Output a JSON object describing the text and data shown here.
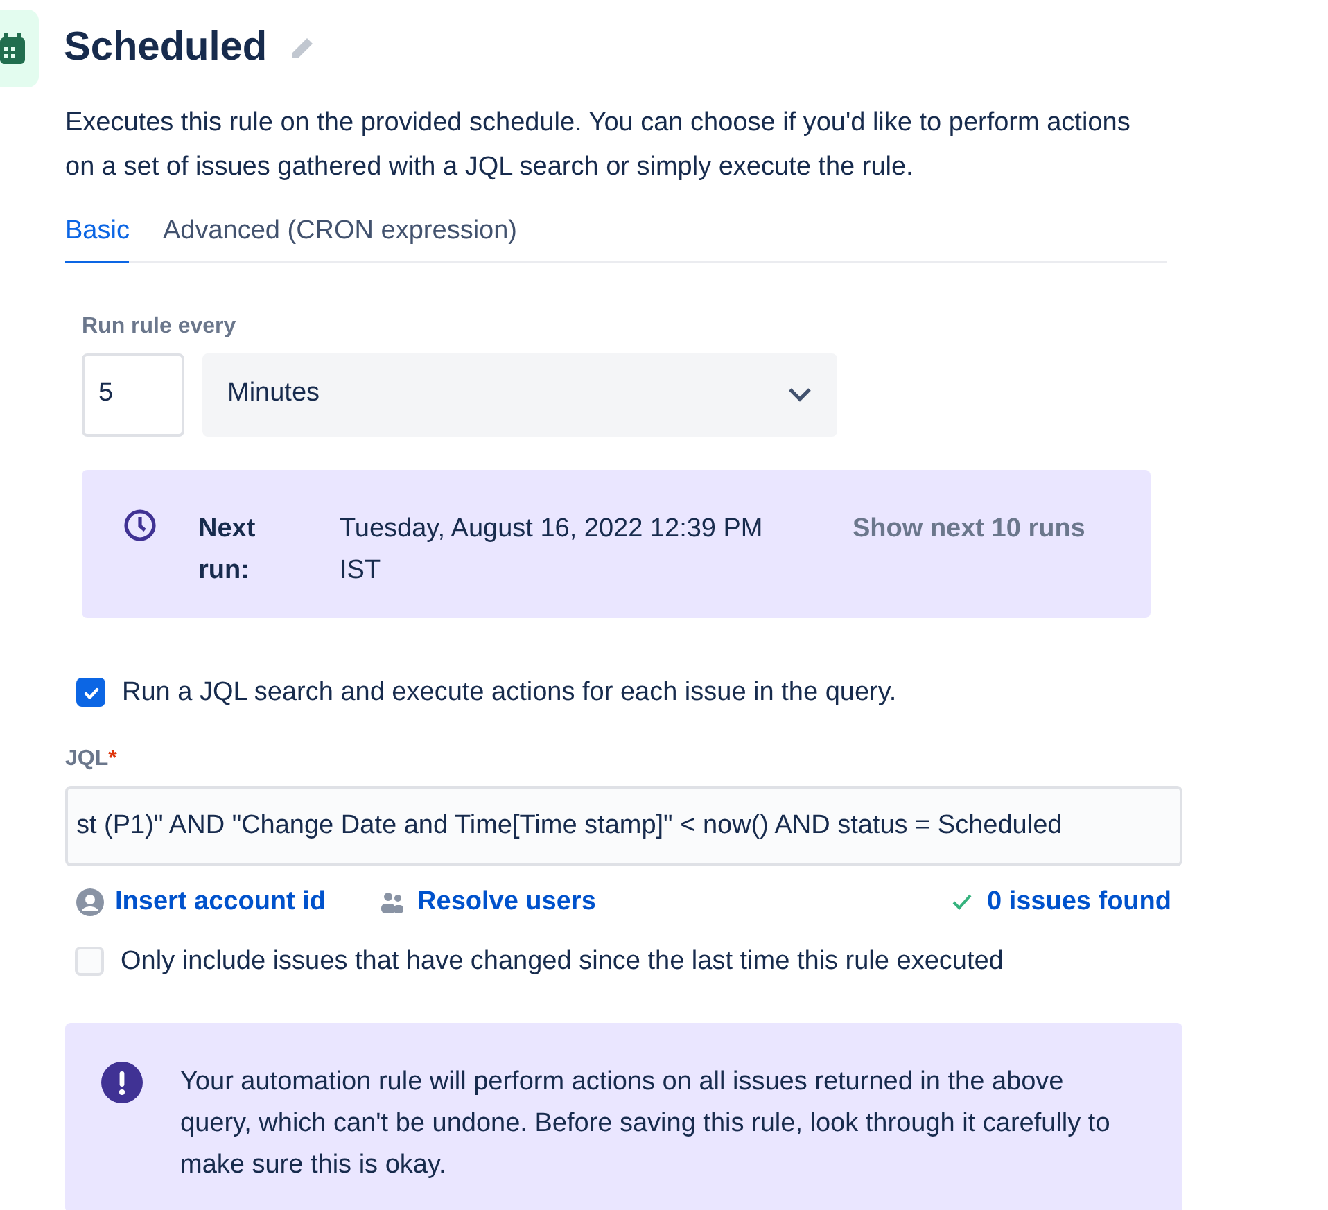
{
  "header": {
    "title": "Scheduled"
  },
  "description": "Executes this rule on the provided schedule. You can choose if you'd like to perform actions on a set of issues gathered with a JQL search or simply execute the rule.",
  "tabs": [
    {
      "label": "Basic",
      "selected": true
    },
    {
      "label": "Advanced (CRON expression)",
      "selected": false
    }
  ],
  "schedule": {
    "label": "Run rule every",
    "interval": "5",
    "unit": "Minutes"
  },
  "next_run": {
    "label": "Next run:",
    "date": "Tuesday, August 16, 2022 12:39 PM",
    "timezone": "IST",
    "link": "Show next 10 runs"
  },
  "jql_search": {
    "label": "Run a JQL search and execute actions for each issue in the query.",
    "checked": true
  },
  "jql": {
    "label": "JQL",
    "required_mark": "*",
    "value": "st (P1)\" AND \"Change Date and Time[Time stamp]\" < now() AND status = Scheduled"
  },
  "jql_links": {
    "insert": "Insert account id",
    "resolve": "Resolve users",
    "result": "0 issues found"
  },
  "changed_only": {
    "label": "Only include issues that have changed since the last time this rule executed",
    "checked": false
  },
  "warning": "Your automation rule will perform actions on all issues returned in the above query, which can't be undone. Before saving this rule, look through it carefully to make sure this is okay."
}
